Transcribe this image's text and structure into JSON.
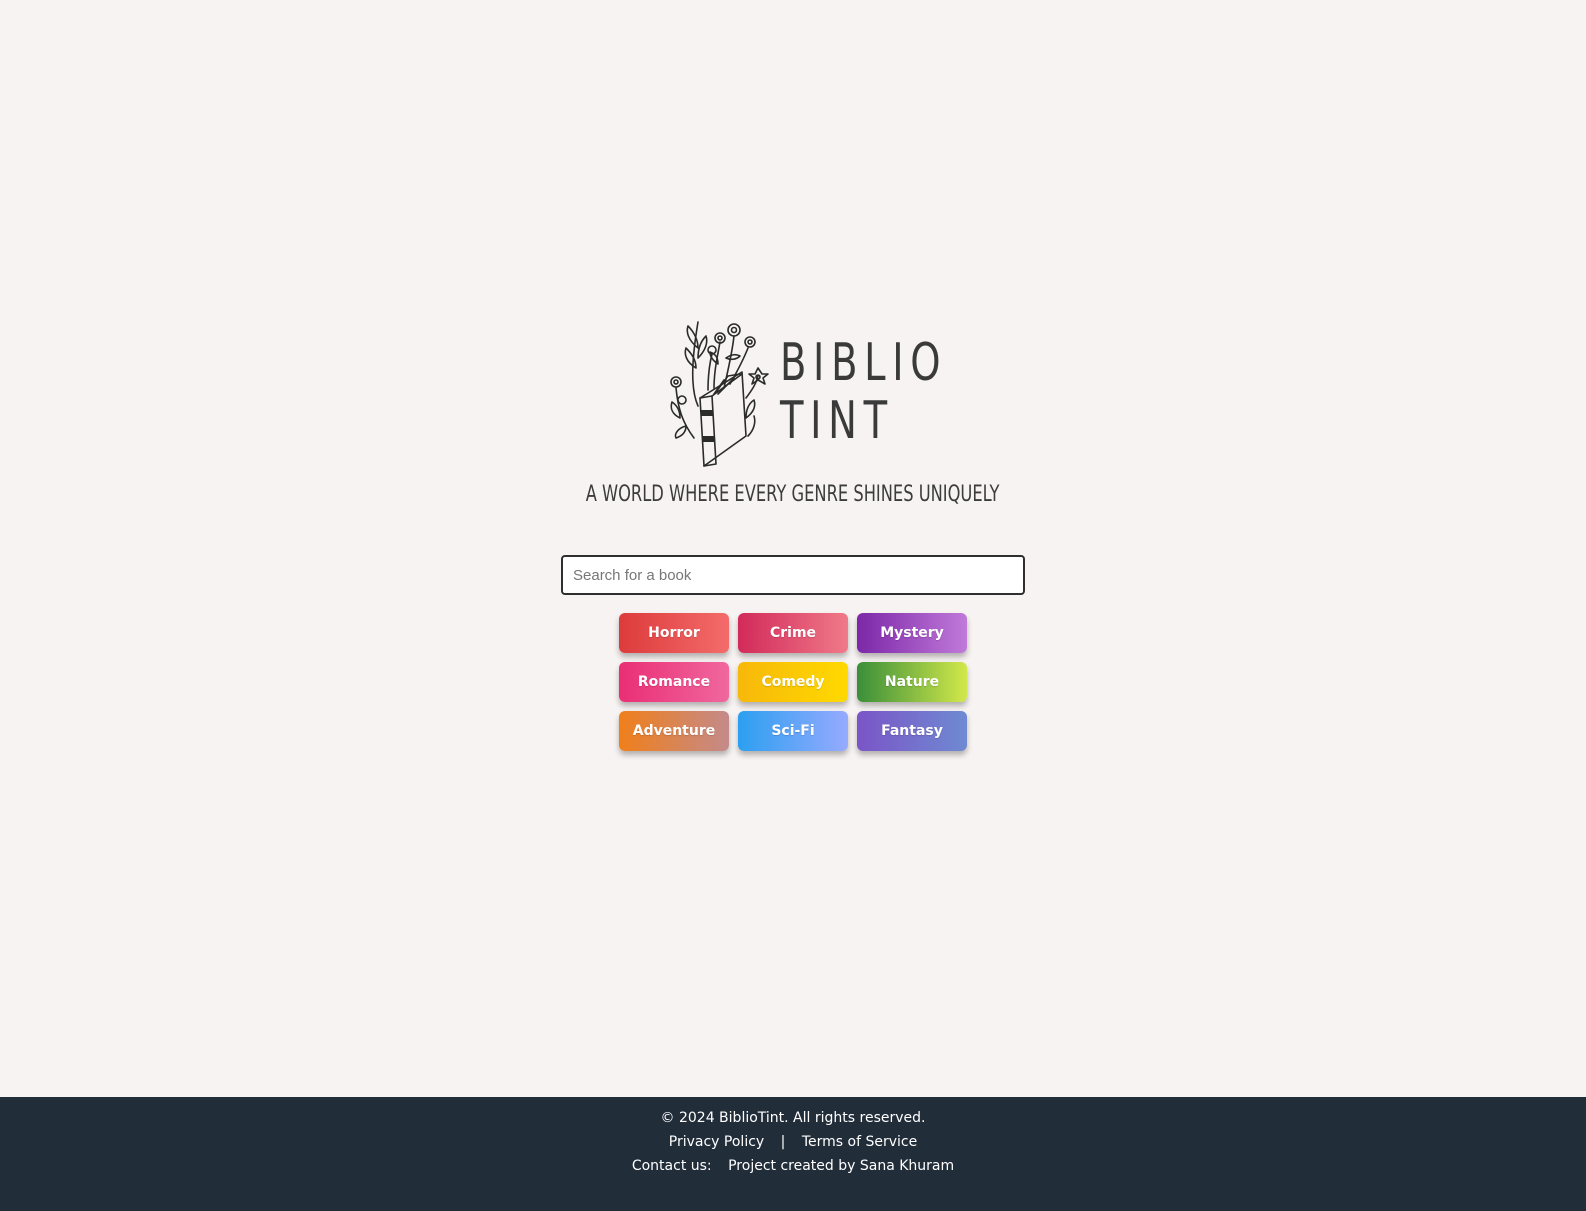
{
  "brand": {
    "line1": "BIBLIO",
    "line2": "TINT",
    "tagline": "A WORLD WHERE EVERY GENRE SHINES UNIQUELY",
    "logo_icon": "book-with-flowers-icon"
  },
  "search": {
    "placeholder": "Search for a book",
    "value": ""
  },
  "genres": [
    {
      "label": "Horror",
      "colors": [
        "#dd3b3b",
        "#f46b6b"
      ]
    },
    {
      "label": "Crime",
      "colors": [
        "#d22a5a",
        "#f07a88"
      ]
    },
    {
      "label": "Mystery",
      "colors": [
        "#7c27a8",
        "#c07ad9"
      ]
    },
    {
      "label": "Romance",
      "colors": [
        "#ea2e76",
        "#f0679e"
      ]
    },
    {
      "label": "Comedy",
      "colors": [
        "#f7b80a",
        "#ffd900"
      ]
    },
    {
      "label": "Nature",
      "colors": [
        "#3a8e3a",
        "#d2e84a"
      ]
    },
    {
      "label": "Adventure",
      "colors": [
        "#f07f1a",
        "#c48a8a"
      ]
    },
    {
      "label": "Sci-Fi",
      "colors": [
        "#2c9ff0",
        "#96aaff"
      ]
    },
    {
      "label": "Fantasy",
      "colors": [
        "#7a55c7",
        "#6f8ad2"
      ]
    }
  ],
  "footer": {
    "copyright": "© 2024 BiblioTint. All rights reserved.",
    "privacy": "Privacy Policy",
    "separator": "|",
    "terms": "Terms of Service",
    "contact_label": "Contact us:",
    "credit": "Project created by Sana Khuram"
  }
}
